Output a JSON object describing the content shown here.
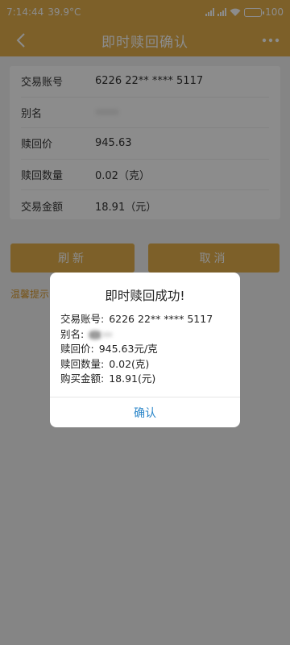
{
  "status_bar": {
    "time": "7:14:44",
    "temperature": "39.9°C",
    "battery": "100"
  },
  "nav": {
    "title": "即时赎回确认"
  },
  "details": {
    "rows": [
      {
        "label": "交易账号",
        "value": "6226 22** **** 5117"
      },
      {
        "label": "别名",
        "value": ""
      },
      {
        "label": "赎回价",
        "value": "945.63"
      },
      {
        "label": "赎回数量",
        "value": "0.02（克）"
      },
      {
        "label": "交易金额",
        "value": "18.91（元）"
      }
    ]
  },
  "buttons": {
    "refresh": "刷新",
    "cancel": "取消"
  },
  "tip": "温馨提示：",
  "dialog": {
    "title": "即时赎回成功!",
    "lines": [
      {
        "key": "交易账号:",
        "value": "6226 22** **** 5117"
      },
      {
        "key": "别名:",
        "value": ""
      },
      {
        "key": "赎回价:",
        "value": "945.63元/克"
      },
      {
        "key": "赎回数量:",
        "value": "0.02(克)"
      },
      {
        "key": "购买金额:",
        "value": "18.91(元)"
      }
    ],
    "confirm": "确认"
  },
  "colors": {
    "primary": "#e3b04b",
    "link": "#2b86c9",
    "tip": "#d99a2b"
  }
}
